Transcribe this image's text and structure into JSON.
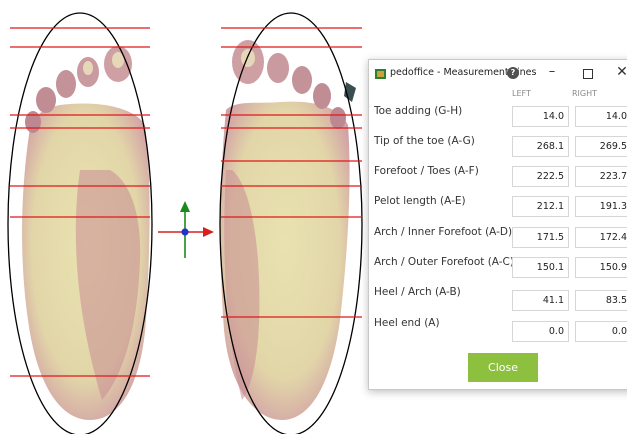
{
  "dialog": {
    "title": "pedoffice - Measurement Lines",
    "help_icon": "?",
    "minimize_icon": "–",
    "close_icon": "✕",
    "col_left": "LEFT",
    "col_right": "RIGHT",
    "close_label": "Close",
    "accent_color": "#8dc03f",
    "rows": [
      {
        "label": "Toe adding (G-H)",
        "left": "14.0",
        "right": "14.0"
      },
      {
        "label": "Tip of the toe (A-G)",
        "left": "268.1",
        "right": "269.5"
      },
      {
        "label": "Forefoot / Toes (A-F)",
        "left": "222.5",
        "right": "223.7"
      },
      {
        "label": "Pelot length (A-E)",
        "left": "212.1",
        "right": "191.3"
      },
      {
        "label": "Arch / Inner Forefoot (A-D)",
        "left": "171.5",
        "right": "172.4"
      },
      {
        "label": "Arch / Outer Forefoot (A-C)",
        "left": "150.1",
        "right": "150.9"
      },
      {
        "label": "Heel / Arch (A-B)",
        "left": "41.1",
        "right": "83.5"
      },
      {
        "label": "Heel end (A)",
        "left": "0.0",
        "right": "0.0"
      }
    ]
  }
}
